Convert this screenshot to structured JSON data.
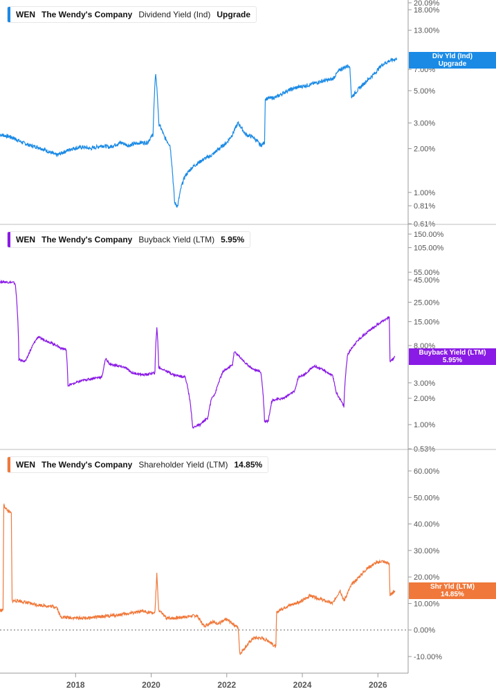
{
  "chart_data": [
    {
      "type": "line",
      "ticker": "WEN",
      "company": "The Wendy's Company",
      "metric": "Dividend Yield (Ind)",
      "current_value": "Upgrade",
      "scale": "log",
      "ylim": [
        0.61,
        20.09
      ],
      "yticks": [
        "20.09%",
        "18.00%",
        "13.00%",
        "7.00%",
        "5.00%",
        "3.00%",
        "2.00%",
        "1.00%",
        "0.81%",
        "0.61%"
      ],
      "ytick_values": [
        20.09,
        18,
        13,
        7,
        5,
        3,
        2,
        1,
        0.81,
        0.61
      ],
      "tag_lines": [
        "Div Yld (Ind)",
        "Upgrade"
      ],
      "tag_value": 8.05,
      "color": "#1a8ae5",
      "series": [
        {
          "x": [
            2016.0,
            2016.3,
            2016.6,
            2016.8,
            2017.0,
            2017.3,
            2017.5,
            2017.7,
            2017.9,
            2018.2,
            2018.4,
            2018.7,
            2018.9,
            2019.2,
            2019.4,
            2019.7,
            2019.9,
            2020.05,
            2020.12,
            2020.2,
            2020.35,
            2020.5,
            2020.58,
            2020.62,
            2020.7,
            2020.8,
            2020.9,
            2021.1,
            2021.25,
            2021.4,
            2021.6,
            2021.8,
            2022.0,
            2022.15,
            2022.3,
            2022.5,
            2022.7,
            2022.9,
            2023.0,
            2023.02,
            2023.3,
            2023.6,
            2023.9,
            2024.2,
            2024.5,
            2024.8,
            2025.0,
            2025.25,
            2025.3,
            2025.6,
            2025.9,
            2026.1,
            2026.3,
            2026.5
          ],
          "y": [
            2.5,
            2.4,
            2.2,
            2.1,
            2.05,
            1.9,
            1.8,
            1.9,
            2.0,
            2.05,
            2.0,
            2.1,
            2.05,
            2.2,
            2.1,
            2.2,
            2.2,
            2.5,
            6.6,
            3.0,
            2.4,
            2.1,
            1.2,
            0.85,
            0.8,
            1.1,
            1.3,
            1.5,
            1.6,
            1.7,
            1.8,
            2.0,
            2.2,
            2.5,
            3.0,
            2.5,
            2.4,
            2.1,
            2.2,
            4.4,
            4.5,
            5.0,
            5.3,
            5.5,
            5.8,
            6.0,
            7.0,
            7.5,
            4.5,
            5.5,
            6.5,
            7.5,
            8.0,
            8.3
          ]
        }
      ]
    },
    {
      "type": "line",
      "ticker": "WEN",
      "company": "The Wendy's Company",
      "metric": "Buyback Yield (LTM)",
      "current_value": "5.95%",
      "scale": "log",
      "ylim": [
        0.53,
        150
      ],
      "yticks": [
        "150.00%",
        "105.00%",
        "55.00%",
        "45.00%",
        "25.00%",
        "15.00%",
        "8.00%",
        "3.00%",
        "2.00%",
        "1.00%",
        "0.53%"
      ],
      "ytick_values": [
        150,
        105,
        55,
        45,
        25,
        15,
        8,
        3,
        2,
        1,
        0.53
      ],
      "tag_lines": [
        "Buyback Yield (LTM)",
        "5.95%"
      ],
      "tag_value": 5.95,
      "color": "#8a1ae5",
      "series": [
        {
          "x": [
            2016.0,
            2016.35,
            2016.4,
            2016.5,
            2016.65,
            2016.7,
            2017.0,
            2017.5,
            2017.6,
            2017.75,
            2017.8,
            2018.2,
            2018.5,
            2018.7,
            2018.8,
            2018.9,
            2019.3,
            2019.5,
            2019.8,
            2020.1,
            2020.15,
            2020.2,
            2020.6,
            2020.9,
            2021.1,
            2021.15,
            2021.3,
            2021.5,
            2021.6,
            2021.7,
            2021.9,
            2022.15,
            2022.2,
            2022.5,
            2022.7,
            2022.9,
            2023.0,
            2023.1,
            2023.2,
            2023.5,
            2023.8,
            2023.9,
            2024.1,
            2024.3,
            2024.6,
            2024.8,
            2024.9,
            2025.1,
            2025.2,
            2025.4,
            2025.9,
            2026.2,
            2026.3,
            2026.32,
            2026.45
          ],
          "y": [
            43,
            42,
            41,
            5.5,
            5.3,
            5.5,
            10,
            8.0,
            7.5,
            7.2,
            2.8,
            3.2,
            3.4,
            3.5,
            5.7,
            4.9,
            4.5,
            3.9,
            3.7,
            3.9,
            13,
            4.5,
            3.7,
            3.5,
            0.9,
            0.95,
            1.0,
            1.2,
            2.0,
            2.3,
            4.0,
            4.8,
            6.8,
            5.0,
            4.3,
            4.0,
            1.1,
            1.1,
            1.9,
            2.0,
            2.4,
            3.5,
            3.8,
            4.7,
            4.1,
            3.6,
            2.3,
            1.6,
            6.3,
            8.5,
            13,
            16,
            17,
            5.2,
            5.95
          ]
        }
      ]
    },
    {
      "type": "line",
      "ticker": "WEN",
      "company": "The Wendy's Company",
      "metric": "Shareholder Yield (LTM)",
      "current_value": "14.85%",
      "scale": "linear",
      "ylim": [
        -14,
        70
      ],
      "yticks": [
        "60.00%",
        "50.00%",
        "40.00%",
        "30.00%",
        "20.00%",
        "10.00%",
        "0.00%",
        "-10.00%"
      ],
      "ytick_values": [
        60,
        50,
        40,
        30,
        20,
        10,
        0,
        -10
      ],
      "tag_lines": [
        "Shr Yld (LTM)",
        "14.85%"
      ],
      "tag_value": 14.85,
      "color": "#f0783a",
      "series": [
        {
          "x": [
            2016.0,
            2016.08,
            2016.1,
            2016.2,
            2016.3,
            2016.32,
            2016.5,
            2016.8,
            2017.0,
            2017.3,
            2017.5,
            2017.6,
            2017.8,
            2018.1,
            2018.3,
            2018.5,
            2018.8,
            2019.0,
            2019.3,
            2019.5,
            2019.8,
            2020.0,
            2020.1,
            2020.15,
            2020.2,
            2020.4,
            2020.6,
            2020.9,
            2021.2,
            2021.4,
            2021.6,
            2021.8,
            2022.0,
            2022.3,
            2022.35,
            2022.4,
            2022.7,
            2022.9,
            2023.1,
            2023.3,
            2023.32,
            2023.4,
            2023.6,
            2023.8,
            2024.0,
            2024.2,
            2024.4,
            2024.6,
            2024.8,
            2025.0,
            2025.1,
            2025.3,
            2025.5,
            2025.7,
            2025.9,
            2026.1,
            2026.3,
            2026.32,
            2026.45
          ],
          "y": [
            7.5,
            7.5,
            47,
            45,
            44,
            11,
            11,
            10,
            9.5,
            9.0,
            8.7,
            5,
            4.7,
            4.5,
            4.5,
            4.8,
            5.2,
            5.5,
            6.0,
            6.5,
            7.0,
            6.5,
            6.5,
            21,
            7.5,
            4.5,
            4.5,
            5,
            5.5,
            1.5,
            3.0,
            2.5,
            4.0,
            1.0,
            -9,
            -8,
            -3,
            -3,
            -4,
            -6.5,
            6.5,
            7.5,
            9,
            10,
            11,
            13,
            12,
            11,
            10,
            15,
            11,
            17,
            20,
            23,
            25,
            26,
            25,
            13,
            14.85
          ]
        }
      ]
    }
  ],
  "x_axis": {
    "range": [
      2016.0,
      2026.8
    ],
    "tick_values": [
      2018,
      2020,
      2022,
      2024,
      2026
    ],
    "tick_labels": [
      "2018",
      "2020",
      "2022",
      "2024",
      "2026"
    ]
  }
}
